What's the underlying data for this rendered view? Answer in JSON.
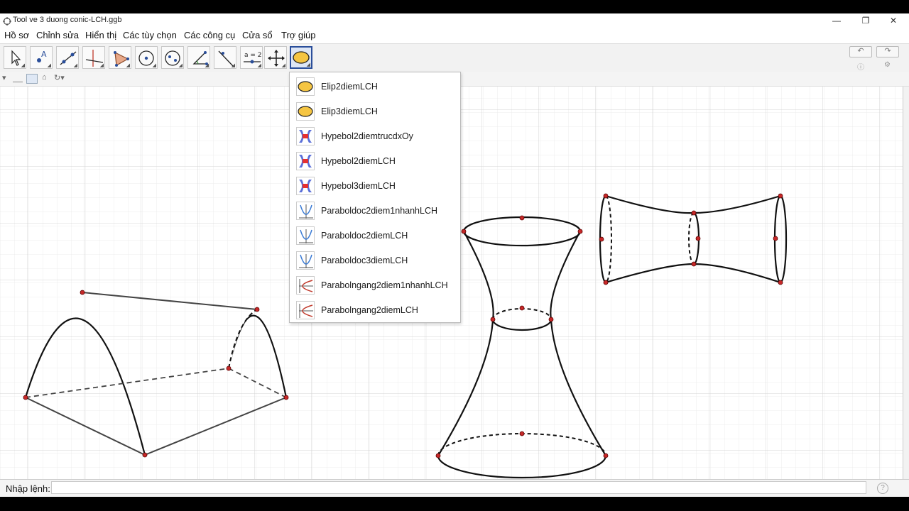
{
  "window": {
    "title": "Tool ve 3 duong conic-LCH.ggb",
    "minimize": "—",
    "maximize": "❐",
    "close": "✕"
  },
  "menu": [
    "Hồ sơ",
    "Chỉnh sửa",
    "Hiển thị",
    "Các tùy chọn",
    "Các công cụ",
    "Cửa sổ",
    "Trợ giúp"
  ],
  "toolbar": {
    "tools": [
      {
        "name": "move-tool",
        "icon": "arrow-cursor-icon"
      },
      {
        "name": "point-tool",
        "icon": "point-A-icon"
      },
      {
        "name": "line-tool",
        "icon": "line-icon"
      },
      {
        "name": "perpendicular-tool",
        "icon": "perpendicular-icon"
      },
      {
        "name": "polygon-tool",
        "icon": "polygon-icon"
      },
      {
        "name": "circle-tool",
        "icon": "circle-icon"
      },
      {
        "name": "conic-tool",
        "icon": "conic-icon"
      },
      {
        "name": "angle-tool",
        "icon": "angle-icon"
      },
      {
        "name": "reflect-tool",
        "icon": "reflect-icon"
      },
      {
        "name": "slider-tool",
        "icon": "slider-icon",
        "label": "a = 2"
      },
      {
        "name": "move-view-tool",
        "icon": "move-graphics-icon"
      },
      {
        "name": "custom-conic-tool",
        "icon": "ellipse-icon",
        "selected": true
      }
    ],
    "undo": "↶",
    "redo": "↷"
  },
  "stylebar": {
    "toggle": "▾",
    "home": "⌂",
    "refresh": "↻▾"
  },
  "dropdown": {
    "items": [
      {
        "label": "Elip2diemLCH",
        "icon": "ellipse-icon"
      },
      {
        "label": "Elip3diemLCH",
        "icon": "ellipse-icon"
      },
      {
        "label": "Hypebol2diemtrucdxOy",
        "icon": "hyperbola-icon"
      },
      {
        "label": "Hypebol2diemLCH",
        "icon": "hyperbola-icon"
      },
      {
        "label": "Hypebol3diemLCH",
        "icon": "hyperbola-icon"
      },
      {
        "label": "Paraboldoc2diem1nhanhLCH",
        "icon": "parabola-vertical-icon"
      },
      {
        "label": "Paraboldoc2diemLCH",
        "icon": "parabola-vertical-icon"
      },
      {
        "label": "Paraboldoc3diemLCH",
        "icon": "parabola-vertical-icon"
      },
      {
        "label": "Parabolngang2diem1nhanhLCH",
        "icon": "parabola-horizontal-icon"
      },
      {
        "label": "Parabolngang2diemLCH",
        "icon": "parabola-horizontal-icon"
      }
    ]
  },
  "inputbar": {
    "label": "Nhập lệnh:",
    "value": "",
    "help": "?"
  },
  "colors": {
    "ellipse_fill": "#f5c542",
    "hyperbola_blue": "#5a6fd8",
    "hyperbola_red": "#e53030",
    "point": "#c62828",
    "grid_minor": "#e9e9e9",
    "grid_major": "#d0d0d0"
  }
}
